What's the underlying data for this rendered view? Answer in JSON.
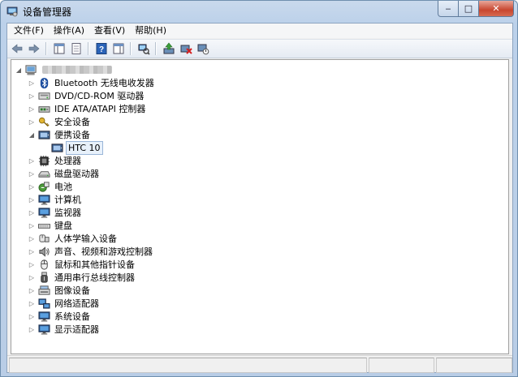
{
  "window": {
    "title": "设备管理器",
    "buttons": {
      "minimize": "‒",
      "maximize": "□",
      "close": "✕"
    }
  },
  "menu": [
    "文件(F)",
    "操作(A)",
    "查看(V)",
    "帮助(H)"
  ],
  "toolbar": [
    {
      "name": "back-arrow-icon"
    },
    {
      "name": "forward-arrow-icon"
    },
    {
      "sep": true
    },
    {
      "name": "properties-pane-icon"
    },
    {
      "name": "page-icon"
    },
    {
      "sep": true
    },
    {
      "name": "help-icon"
    },
    {
      "name": "action-pane-icon"
    },
    {
      "sep": true
    },
    {
      "name": "scan-hardware-icon"
    },
    {
      "sep": true
    },
    {
      "name": "update-driver-icon"
    },
    {
      "name": "uninstall-icon"
    },
    {
      "name": "disable-icon"
    }
  ],
  "tree": {
    "root": {
      "icon": "computer-icon",
      "label_hidden": true
    },
    "items": [
      {
        "label": "Bluetooth 无线电收发器",
        "icon": "bluetooth-icon",
        "expanded": false
      },
      {
        "label": "DVD/CD-ROM 驱动器",
        "icon": "dvd-drive-icon",
        "expanded": false
      },
      {
        "label": "IDE ATA/ATAPI 控制器",
        "icon": "ide-controller-icon",
        "expanded": false
      },
      {
        "label": "安全设备",
        "icon": "security-key-icon",
        "expanded": false
      },
      {
        "label": "便携设备",
        "icon": "portable-device-icon",
        "expanded": true,
        "children": [
          {
            "label": "HTC 10",
            "icon": "portable-device-icon",
            "selected": true
          }
        ]
      },
      {
        "label": "处理器",
        "icon": "processor-icon",
        "expanded": false
      },
      {
        "label": "磁盘驱动器",
        "icon": "disk-drive-icon",
        "expanded": false
      },
      {
        "label": "电池",
        "icon": "battery-icon",
        "expanded": false
      },
      {
        "label": "计算机",
        "icon": "monitor-icon",
        "expanded": false
      },
      {
        "label": "监视器",
        "icon": "monitor-icon",
        "expanded": false
      },
      {
        "label": "键盘",
        "icon": "keyboard-icon",
        "expanded": false
      },
      {
        "label": "人体学输入设备",
        "icon": "hid-icon",
        "expanded": false
      },
      {
        "label": "声音、视频和游戏控制器",
        "icon": "speaker-icon",
        "expanded": false
      },
      {
        "label": "鼠标和其他指针设备",
        "icon": "mouse-icon",
        "expanded": false
      },
      {
        "label": "通用串行总线控制器",
        "icon": "usb-icon",
        "expanded": false
      },
      {
        "label": "图像设备",
        "icon": "scanner-icon",
        "expanded": false
      },
      {
        "label": "网络适配器",
        "icon": "network-icon",
        "expanded": false
      },
      {
        "label": "系统设备",
        "icon": "monitor-icon",
        "expanded": false
      },
      {
        "label": "显示适配器",
        "icon": "monitor-icon",
        "expanded": false
      }
    ]
  },
  "colors": {
    "accent": "#1c5c9c",
    "selection_bg": "#e8f1fb",
    "selection_border": "#9ab6d8"
  }
}
